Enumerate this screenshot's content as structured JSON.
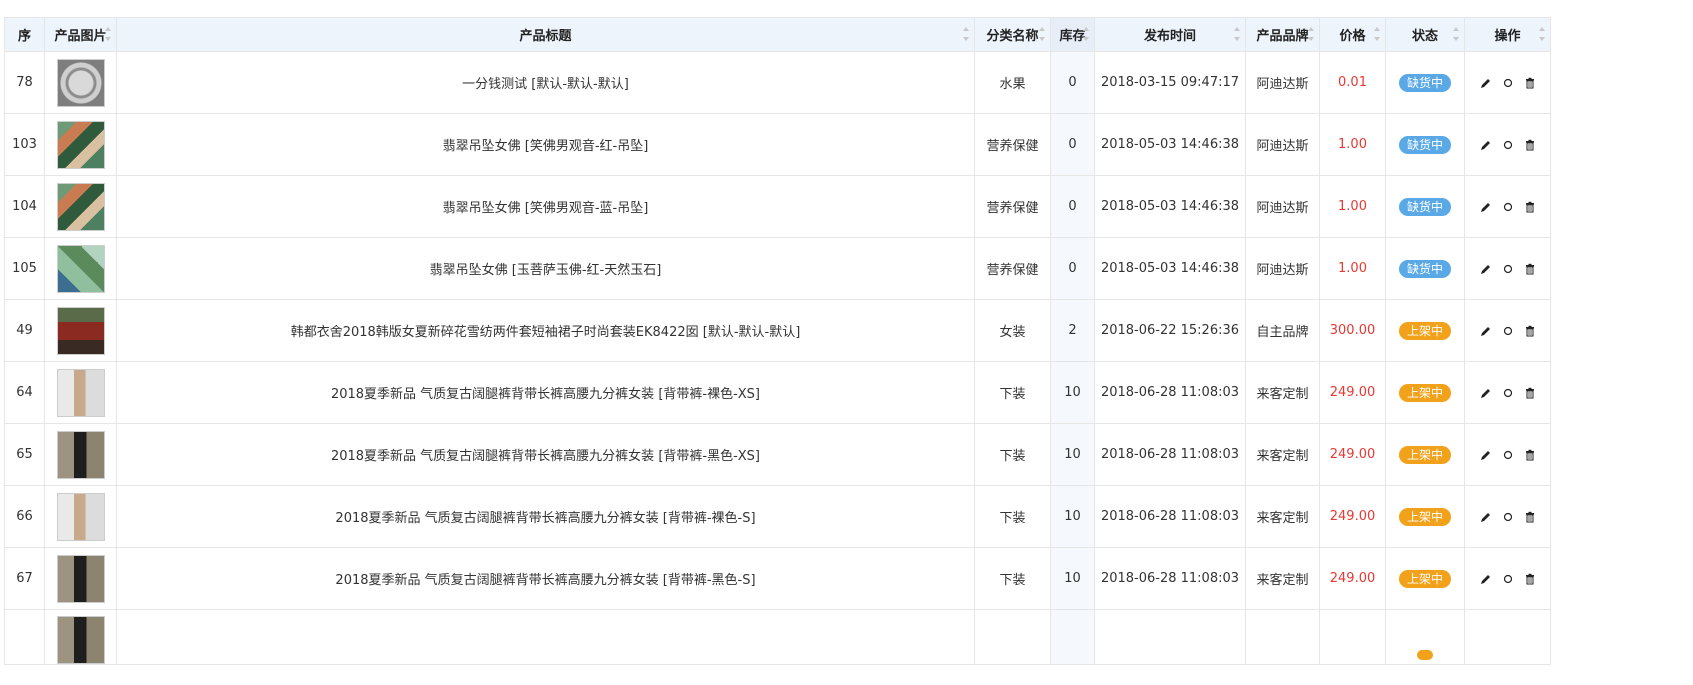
{
  "columns": [
    {
      "label": "序"
    },
    {
      "label": "产品图片"
    },
    {
      "label": "产品标题"
    },
    {
      "label": "分类名称"
    },
    {
      "label": "库存"
    },
    {
      "label": "发布时间"
    },
    {
      "label": "产品品牌"
    },
    {
      "label": "价格"
    },
    {
      "label": "状态"
    },
    {
      "label": "操作"
    }
  ],
  "rows": [
    {
      "id": "78",
      "thumb": "coin",
      "title": "一分钱测试 [默认-默认-默认]",
      "category": "水果",
      "stock": "0",
      "time": "2018-03-15 09:47:17",
      "brand": "阿迪达斯",
      "price": "0.01",
      "status": "缺货中",
      "status_type": "out"
    },
    {
      "id": "103",
      "thumb": "jade",
      "title": "翡翠吊坠女佛 [笑佛男观音-红-吊坠]",
      "category": "营养保健",
      "stock": "0",
      "time": "2018-05-03 14:46:38",
      "brand": "阿迪达斯",
      "price": "1.00",
      "status": "缺货中",
      "status_type": "out"
    },
    {
      "id": "104",
      "thumb": "jade",
      "title": "翡翠吊坠女佛 [笑佛男观音-蓝-吊坠]",
      "category": "营养保健",
      "stock": "0",
      "time": "2018-05-03 14:46:38",
      "brand": "阿迪达斯",
      "price": "1.00",
      "status": "缺货中",
      "status_type": "out"
    },
    {
      "id": "105",
      "thumb": "jade2",
      "title": "翡翠吊坠女佛 [玉菩萨玉佛-红-天然玉石]",
      "category": "营养保健",
      "stock": "0",
      "time": "2018-05-03 14:46:38",
      "brand": "阿迪达斯",
      "price": "1.00",
      "status": "缺货中",
      "status_type": "out"
    },
    {
      "id": "49",
      "thumb": "dress",
      "title": "韩都衣舍2018韩版女夏新碎花雪纺两件套短袖裙子时尚套装EK8422囡 [默认-默认-默认]",
      "category": "女装",
      "stock": "2",
      "time": "2018-06-22 15:26:36",
      "brand": "自主品牌",
      "price": "300.00",
      "status": "上架中",
      "status_type": "up"
    },
    {
      "id": "64",
      "thumb": "pants-light",
      "title": "2018夏季新品 气质复古阔腿裤背带长裤高腰九分裤女装 [背带裤-裸色-XS]",
      "category": "下装",
      "stock": "10",
      "time": "2018-06-28 11:08:03",
      "brand": "来客定制",
      "price": "249.00",
      "status": "上架中",
      "status_type": "up"
    },
    {
      "id": "65",
      "thumb": "pants-dark",
      "title": "2018夏季新品 气质复古阔腿裤背带长裤高腰九分裤女装 [背带裤-黑色-XS]",
      "category": "下装",
      "stock": "10",
      "time": "2018-06-28 11:08:03",
      "brand": "来客定制",
      "price": "249.00",
      "status": "上架中",
      "status_type": "up"
    },
    {
      "id": "66",
      "thumb": "pants-light",
      "title": "2018夏季新品 气质复古阔腿裤背带长裤高腰九分裤女装 [背带裤-裸色-S]",
      "category": "下装",
      "stock": "10",
      "time": "2018-06-28 11:08:03",
      "brand": "来客定制",
      "price": "249.00",
      "status": "上架中",
      "status_type": "up"
    },
    {
      "id": "67",
      "thumb": "pants-dark",
      "title": "2018夏季新品 气质复古阔腿裤背带长裤高腰九分裤女装 [背带裤-黑色-S]",
      "category": "下装",
      "stock": "10",
      "time": "2018-06-28 11:08:03",
      "brand": "来客定制",
      "price": "249.00",
      "status": "上架中",
      "status_type": "up"
    }
  ],
  "partial_row": {
    "thumb": "pants-dark",
    "status_type": "up"
  },
  "icons": {
    "edit": "pencil-icon",
    "toggle": "circle-icon",
    "delete": "trash-icon"
  },
  "colors": {
    "price": "#e53935",
    "status_out": "#5aa9e6",
    "status_up": "#f2a11a",
    "header_bg": "#eef4fb"
  }
}
